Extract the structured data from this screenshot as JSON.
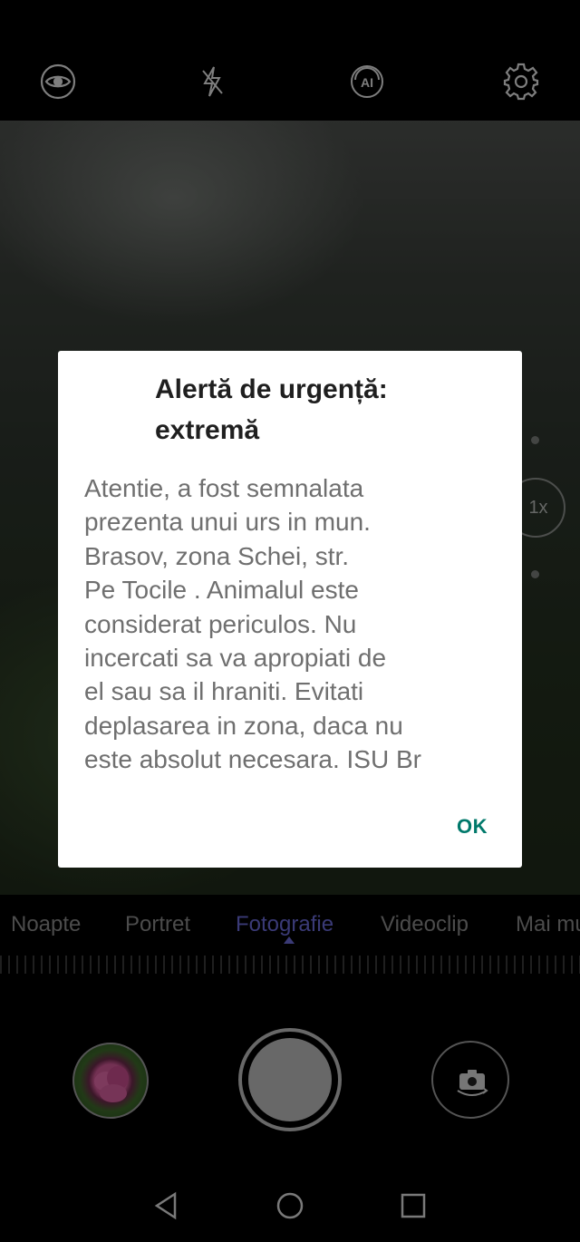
{
  "camera": {
    "top_bar": {
      "icons": [
        "eye-beauty-icon",
        "flash-off-icon",
        "ai-mode-icon",
        "gear-icon"
      ]
    },
    "zoom_label": "1x",
    "modes": [
      {
        "label": "Noapte",
        "active": false
      },
      {
        "label": "Portret",
        "active": false
      },
      {
        "label": "Fotografie",
        "active": true
      },
      {
        "label": "Videoclip",
        "active": false
      },
      {
        "label": "Mai mult",
        "active": false
      }
    ],
    "controls": {
      "gallery_thumbnail": "gallery-thumbnail",
      "shutter": "shutter-button",
      "switch_camera": "switch-camera-icon"
    },
    "accent_color": "#6a6ad8"
  },
  "dialog": {
    "title": "Alertă de urgență: extremă",
    "body": "Atentie, a fost semnalata\nprezenta unui urs in mun.\nBrasov, zona Schei, str.\nPe Tocile  . Animalul este\nconsiderat periculos. Nu\nincercati sa va apropiati de\nel sau sa il hraniti. Evitati\ndeplasarea in zona, daca nu\neste absolut necesara. ISU Br",
    "ok_label": "OK",
    "ok_color": "#00796b"
  },
  "navbar": {
    "icons": [
      "back-icon",
      "home-icon",
      "recents-icon"
    ]
  }
}
